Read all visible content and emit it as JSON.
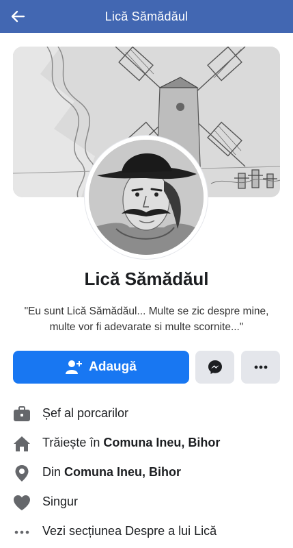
{
  "header": {
    "title": "Lică Sămădăul",
    "back_icon": "arrow-left-icon",
    "background": "#4267b2"
  },
  "profile": {
    "name": "Lică Sămădăul",
    "bio": "\"Eu sunt Lică Sămădăul... Multe se zic despre mine, multe vor fi adevarate si multe scornite...\"",
    "cover_icon": "windmill-drawing",
    "avatar_icon": "portrait-drawing"
  },
  "actions": {
    "add_label": "Adaugă",
    "add_icon": "add-friend-icon",
    "messenger_icon": "messenger-icon",
    "more_icon": "more-dots-icon",
    "primary_color": "#1877f2"
  },
  "info": {
    "work": {
      "icon": "briefcase-icon",
      "text": "Șef al porcarilor"
    },
    "lives": {
      "icon": "home-icon",
      "prefix": "Trăiește în ",
      "place": "Comuna Ineu, Bihor"
    },
    "from": {
      "icon": "location-pin-icon",
      "prefix": "Din ",
      "place": "Comuna Ineu, Bihor"
    },
    "relationship": {
      "icon": "heart-icon",
      "text": "Singur"
    },
    "about": {
      "icon": "more-dots-icon",
      "text": "Vezi secțiunea Despre a lui Lică"
    }
  }
}
